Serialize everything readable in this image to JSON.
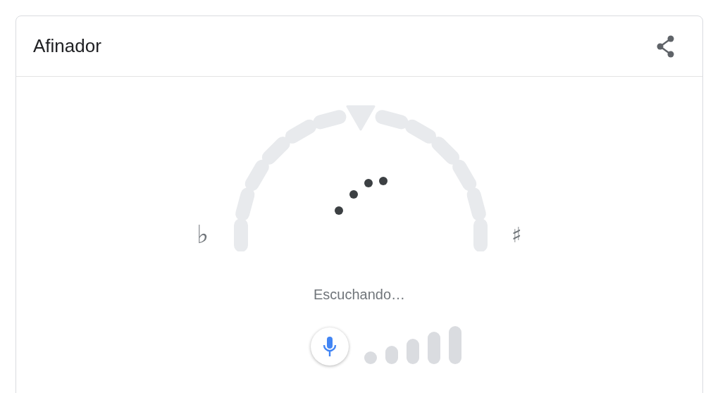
{
  "card": {
    "title": "Afinador"
  },
  "tuner": {
    "flat_sign": "♭",
    "sharp_sign": "♯",
    "status": "Escuchando…"
  }
}
